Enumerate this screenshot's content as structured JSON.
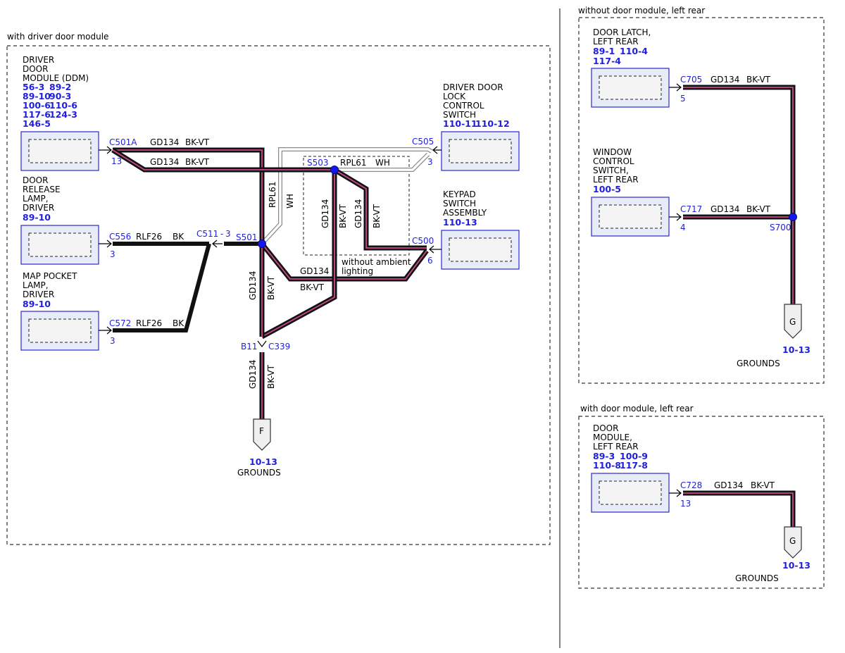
{
  "frames": {
    "driver": "with driver door module",
    "rear_no_module": "without door module, left rear",
    "rear_module": "with door module, left rear"
  },
  "components": {
    "ddm": {
      "name": [
        "DRIVER",
        "DOOR",
        "MODULE (DDM)"
      ],
      "refs": [
        "56-3",
        "89-2",
        "89-10",
        "90-3",
        "100-6",
        "110-6",
        "117-6",
        "124-3",
        "146-5"
      ]
    },
    "release": {
      "name": [
        "DOOR",
        "RELEASE",
        "LAMP,",
        "DRIVER"
      ],
      "refs": [
        "89-10"
      ]
    },
    "map": {
      "name": [
        "MAP POCKET",
        "LAMP,",
        "DRIVER"
      ],
      "refs": [
        "89-10"
      ]
    },
    "lock": {
      "name": [
        "DRIVER DOOR",
        "LOCK",
        "CONTROL",
        "SWITCH"
      ],
      "refs": [
        "110-11",
        "110-12"
      ]
    },
    "keypad": {
      "name": [
        "KEYPAD",
        "SWITCH",
        "ASSEMBLY"
      ],
      "refs": [
        "110-13"
      ]
    },
    "latch": {
      "name": [
        "DOOR LATCH,",
        "LEFT REAR"
      ],
      "refs": [
        "89-1",
        "110-4",
        "117-4"
      ]
    },
    "window": {
      "name": [
        "WINDOW",
        "CONTROL",
        "SWITCH,",
        "LEFT REAR"
      ],
      "refs": [
        "100-5"
      ]
    },
    "rearmod": {
      "name": [
        "DOOR",
        "MODULE,",
        "LEFT REAR"
      ],
      "refs": [
        "89-3",
        "100-9",
        "110-8",
        "117-8"
      ]
    }
  },
  "connectors": {
    "c501a": "C501A",
    "c501a_pin": "13",
    "c556": "C556",
    "c556_pin": "3",
    "c572": "C572",
    "c572_pin": "3",
    "c505": "C505",
    "c505_pin": "3",
    "c500": "C500",
    "c500_pin": "6",
    "c511": "C511",
    "c511_pin": "3",
    "b11": "B11",
    "c339": "C339",
    "c705": "C705",
    "c705_pin": "5",
    "c717": "C717",
    "c717_pin": "4",
    "c728": "C728",
    "c728_pin": "13"
  },
  "splices": {
    "s501": "S501",
    "s503": "S503",
    "s700": "S700"
  },
  "wires": {
    "gd134": "GD134",
    "bkvt": "BK-VT",
    "rlf26": "RLF26",
    "bk": "BK",
    "rpl61": "RPL61",
    "wh": "WH"
  },
  "notes": {
    "ambient": [
      "without ambient",
      "lighting"
    ]
  },
  "grounds": {
    "f": {
      "letter": "F",
      "ref": "10-13",
      "label": "GROUNDS"
    },
    "g1": {
      "letter": "G",
      "ref": "10-13",
      "label": "GROUNDS"
    },
    "g2": {
      "letter": "G",
      "ref": "10-13",
      "label": "GROUNDS"
    }
  },
  "colors": {
    "ref_link": "#1f1fdc",
    "connector_blue": "#2a2ad0",
    "wire_stripe": "#c84a8a",
    "splice": "#1515f0"
  }
}
